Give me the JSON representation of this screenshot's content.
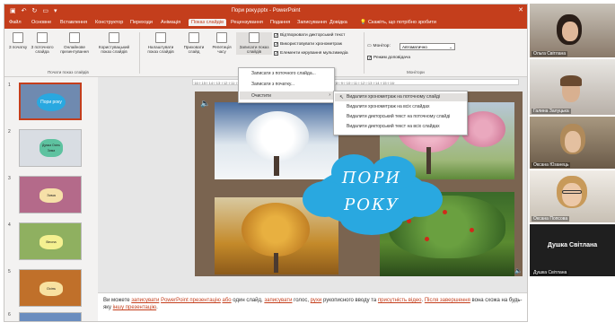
{
  "app": {
    "title": "Пори року.pptx - PowerPoint",
    "qat_icons": [
      "save-icon",
      "undo-icon",
      "redo-icon",
      "start-slideshow-icon"
    ]
  },
  "tabs": [
    {
      "label": "Файл"
    },
    {
      "label": "Основне"
    },
    {
      "label": "Вставлення"
    },
    {
      "label": "Конструктор"
    },
    {
      "label": "Переходи"
    },
    {
      "label": "Анімація"
    },
    {
      "label": "Показ слайдів",
      "active": true
    },
    {
      "label": "Рецензування"
    },
    {
      "label": "Подання"
    },
    {
      "label": "Записування"
    },
    {
      "label": "Довідка"
    },
    {
      "label": "Скажіть, що потрібно зробити"
    }
  ],
  "ribbon": {
    "btn_from_start": "З початку",
    "btn_from_current": "З поточного слайда",
    "btn_online": "Онлайнове презентування",
    "btn_custom": "Користувацький показ слайдів",
    "group_start": "Почати показ слайдів",
    "btn_setup": "Налаштувати показ слайдів",
    "btn_hide": "Приховати слайд",
    "btn_rehearse": "Репетиція часу",
    "btn_record": "Записати показ слайдів",
    "chk_narration": "Відтворювати дикторський текст",
    "chk_timings": "Використовувати хронометраж",
    "chk_media": "Елементи керування мультимедіа",
    "monitor_label": "Монітор:",
    "monitor_value": "Автоматично",
    "chk_presenter": "Режим доповідача",
    "group_monitors": "Монітори"
  },
  "record_menu": {
    "items": [
      "Записати з поточного слайда...",
      "Записати з початку...",
      "Очистити"
    ]
  },
  "clear_menu": {
    "items": [
      "Видалити хронометраж на поточному слайді",
      "Видалити хронометраж на всіх слайдах",
      "Видалити дикторський текст на поточному слайді",
      "Видалити дикторський текст на всіх слайдах"
    ]
  },
  "slides": [
    {
      "num": "1",
      "title": "Пори року"
    },
    {
      "num": "2",
      "title": "Думка Осінь Зима"
    },
    {
      "num": "3",
      "title": "Зима"
    },
    {
      "num": "4",
      "title": "Весна"
    },
    {
      "num": "5",
      "title": "Осінь"
    },
    {
      "num": "6",
      "title": ""
    }
  ],
  "slide_main": {
    "title_line1": "ПОРИ",
    "title_line2": "РОКУ"
  },
  "ruler_text": "·16·|·15·|·14·|·13·|·12·|·11·|·10·|·9·|·8·|·7·|·6·|·5·|·4·|·3·|·2·|·1·|·0·|·1·|·2·|·3·|·4·|·5·|·6·|·7·|·8·|·9·|·10·|·11·|·12·|·13·|·14·|·15·|·16·",
  "notes": {
    "p1": "Ви можете ",
    "l1": "записувати",
    "p2": " ",
    "l2": "PowerPoint презентацію",
    "p3": " ",
    "l3": "або",
    "p4": " один слайд, ",
    "l4": "записувати",
    "p5": " голос, ",
    "l5": "рухи",
    "p6": " рукописного вводу та ",
    "l6": "присутність відео",
    "p7": ". ",
    "l7": "Після завершення",
    "p8": " вона схожа на будь-яку ",
    "l8": "іншу презентацію",
    "p9": "."
  },
  "participants": [
    {
      "name": "Ольга Світлана"
    },
    {
      "name": "Галина Залуцька"
    },
    {
      "name": "Оксана Юзанець"
    },
    {
      "name": "Оксана Попсова"
    },
    {
      "name": "Душка Світлана",
      "label": "Душка Світлана"
    }
  ],
  "colors": {
    "accent": "#c43e1c",
    "cloud": "#29a8e0",
    "slide_bg": "#7a6450"
  }
}
